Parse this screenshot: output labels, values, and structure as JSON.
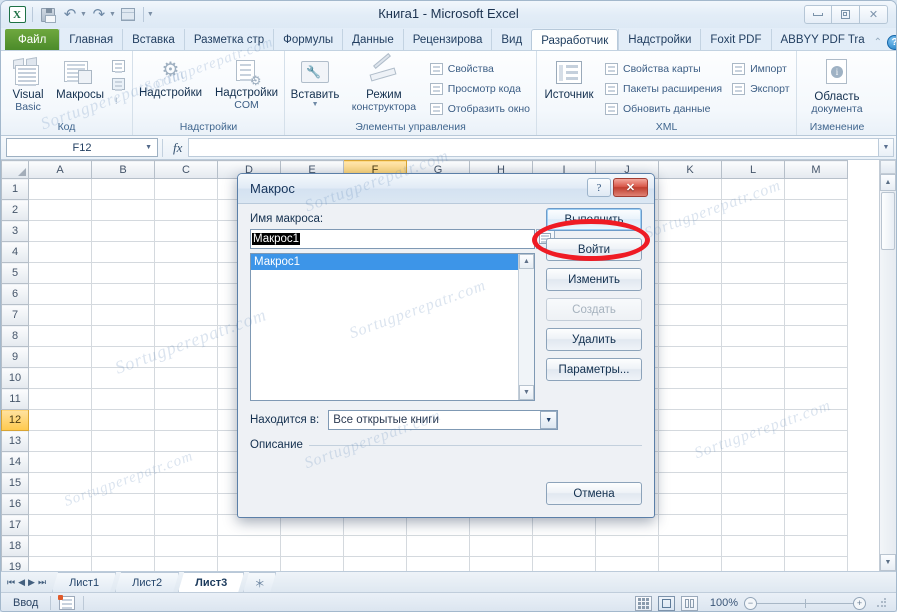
{
  "window": {
    "title": "Книга1  -  Microsoft Excel",
    "quick_access": [
      {
        "name": "excel-logo",
        "label": "X"
      },
      {
        "name": "save",
        "label": "Сохранить"
      },
      {
        "name": "undo",
        "label": "Отменить"
      },
      {
        "name": "redo",
        "label": "Вернуть"
      },
      {
        "name": "quick-print",
        "label": "Быстрая печать"
      },
      {
        "name": "customize",
        "label": "Настройка панели быстрого доступа"
      }
    ],
    "controls": {
      "minimize": "—",
      "restore": "❐",
      "close": "✕"
    }
  },
  "ribbon": {
    "tabs": [
      {
        "label": "Файл",
        "state": "file"
      },
      {
        "label": "Главная",
        "state": "normal"
      },
      {
        "label": "Вставка",
        "state": "normal"
      },
      {
        "label": "Разметка стр",
        "state": "normal"
      },
      {
        "label": "Формулы",
        "state": "normal"
      },
      {
        "label": "Данные",
        "state": "normal"
      },
      {
        "label": "Рецензирова",
        "state": "normal"
      },
      {
        "label": "Вид",
        "state": "normal"
      },
      {
        "label": "Разработчик",
        "state": "active"
      },
      {
        "label": "Надстройки",
        "state": "normal"
      },
      {
        "label": "Foxit PDF",
        "state": "normal"
      },
      {
        "label": "ABBYY PDF Tra",
        "state": "normal"
      }
    ],
    "help_label": "?",
    "groups": [
      {
        "title": "Код",
        "big_buttons": [
          {
            "label_line1": "Visual",
            "label_line2": "Basic",
            "icon": "visual-basic-icon"
          },
          {
            "label_line1": "Макросы",
            "label_line2": "",
            "icon": "macros-icon"
          }
        ],
        "small_buttons": [
          {
            "label": "",
            "icon": "record-macro-icon"
          },
          {
            "label": "",
            "icon": "relative-references-icon"
          },
          {
            "label": "",
            "icon": "macro-security-icon"
          }
        ]
      },
      {
        "title": "Надстройки",
        "big_buttons": [
          {
            "label_line1": "Надстройки",
            "label_line2": "",
            "icon": "add-ins-icon"
          },
          {
            "label_line1": "Надстройки",
            "label_line2": "COM",
            "icon": "com-add-ins-icon"
          }
        ],
        "small_buttons": []
      },
      {
        "title": "Элементы управления",
        "big_buttons": [
          {
            "label_line1": "Вставить",
            "label_line2": "",
            "icon": "insert-control-icon"
          },
          {
            "label_line1": "Режим",
            "label_line2": "конструктора",
            "icon": "design-mode-icon"
          }
        ],
        "small_buttons": [
          {
            "label": "Свойства",
            "icon": "properties-icon"
          },
          {
            "label": "Просмотр кода",
            "icon": "view-code-icon"
          },
          {
            "label": "Отобразить окно",
            "icon": "show-dialog-icon"
          }
        ]
      },
      {
        "title": "XML",
        "big_buttons": [
          {
            "label_line1": "Источник",
            "label_line2": "",
            "icon": "xml-source-icon"
          }
        ],
        "small_buttons": [
          {
            "label": "Свойства карты",
            "icon": "map-properties-icon"
          },
          {
            "label": "Пакеты расширения",
            "icon": "expansion-packs-icon"
          },
          {
            "label": "Обновить данные",
            "icon": "refresh-data-icon"
          },
          {
            "label": "Импорт",
            "icon": "import-icon"
          },
          {
            "label": "Экспорт",
            "icon": "export-icon"
          }
        ]
      },
      {
        "title": "Изменение",
        "big_buttons": [
          {
            "label_line1": "Область",
            "label_line2": "документа",
            "icon": "document-panel-icon"
          }
        ],
        "small_buttons": []
      }
    ]
  },
  "formula_bar": {
    "name_box": "F12",
    "fx_label": "fx",
    "formula_value": ""
  },
  "grid": {
    "columns": [
      "A",
      "B",
      "C",
      "D",
      "E",
      "F",
      "G",
      "H",
      "I",
      "J",
      "K",
      "L",
      "M"
    ],
    "rows": [
      1,
      2,
      3,
      4,
      5,
      6,
      7,
      8,
      9,
      10,
      11,
      12,
      13,
      14,
      15,
      16,
      17,
      18,
      19
    ],
    "selected_row": 12,
    "selected_column": "F"
  },
  "sheet_tabs": {
    "nav": [
      "⏮",
      "◀",
      "▶",
      "⏭"
    ],
    "tabs": [
      {
        "label": "Лист1",
        "active": false
      },
      {
        "label": "Лист2",
        "active": false
      },
      {
        "label": "Лист3",
        "active": true
      }
    ],
    "new_sheet_label": "＊"
  },
  "status_bar": {
    "mode": "Ввод",
    "zoom": "100%",
    "views": [
      "normal-view",
      "page-layout-view",
      "page-break-view"
    ]
  },
  "dialog": {
    "title": "Макрос",
    "help_label": "?",
    "close_label": "✕",
    "macro_name_label": "Имя макроса:",
    "macro_name_value": "Макрос1",
    "macro_list": [
      {
        "label": "Макрос1",
        "selected": true
      }
    ],
    "location_label": "Находится в:",
    "location_value": "Все открытые книги",
    "description_label": "Описание",
    "description_value": "",
    "buttons": [
      {
        "label": "Выполнить",
        "state": "primary"
      },
      {
        "label": "Войти",
        "state": "normal"
      },
      {
        "label": "Изменить",
        "state": "normal"
      },
      {
        "label": "Создать",
        "state": "disabled"
      },
      {
        "label": "Удалить",
        "state": "normal"
      },
      {
        "label": "Параметры...",
        "state": "normal"
      }
    ],
    "cancel_label": "Отмена",
    "highlight_color": "#ef1b24",
    "highlighted_button": "Выполнить"
  },
  "watermarks": [
    {
      "text": "Sortugperepatr.com"
    },
    {
      "text": "Sortugperepatr.com"
    },
    {
      "text": "Sortugperepatr.com"
    },
    {
      "text": "Sortugperepatr.com"
    },
    {
      "text": "Sortugperepatr.com"
    },
    {
      "text": "Sortugperepatr.com"
    },
    {
      "text": "Sortugperepatr.com"
    },
    {
      "text": "Sortugperepatr.com"
    },
    {
      "text": "Sortugperepatr.com"
    }
  ]
}
